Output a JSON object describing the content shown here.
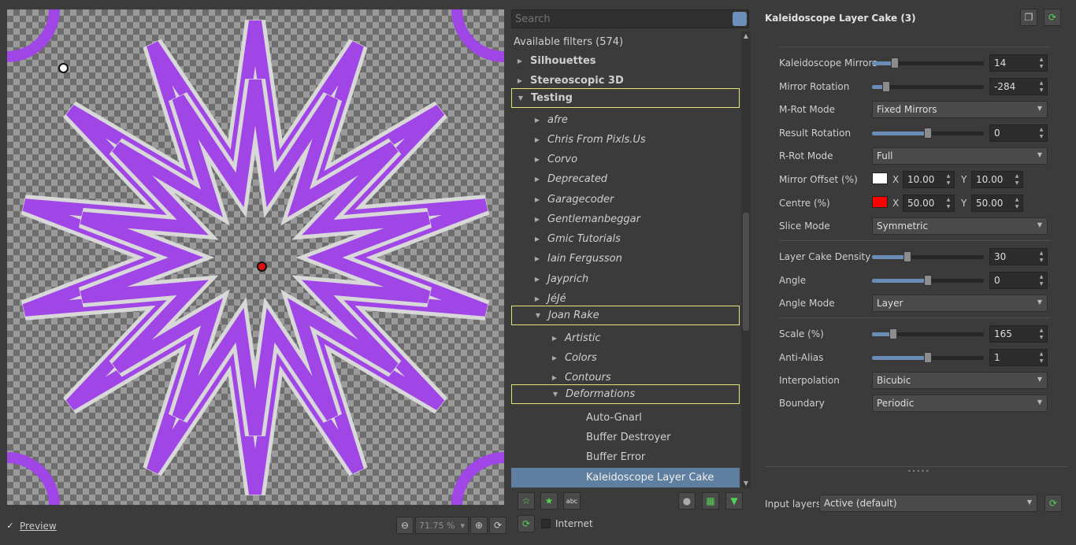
{
  "preview": {
    "checkbox_mark": "✓",
    "label": "Preview",
    "zoom": "71.75 %",
    "zoom_caret": "▾"
  },
  "search": {
    "placeholder": "Search"
  },
  "tree": {
    "header": "Available filters (574)",
    "rows": [
      {
        "label": "Silhouettes",
        "arrow": "▶"
      },
      {
        "label": "Stereoscopic 3D",
        "arrow": "▶"
      },
      {
        "label": "Testing",
        "arrow": "▼"
      },
      {
        "label": "afre",
        "arrow": "▶"
      },
      {
        "label": "Chris From Pixls.Us",
        "arrow": "▶"
      },
      {
        "label": "Corvo",
        "arrow": "▶"
      },
      {
        "label": "Deprecated",
        "arrow": "▶"
      },
      {
        "label": "Garagecoder",
        "arrow": "▶"
      },
      {
        "label": "Gentlemanbeggar",
        "arrow": "▶"
      },
      {
        "label": "Gmic Tutorials",
        "arrow": "▶"
      },
      {
        "label": "Iain Fergusson",
        "arrow": "▶"
      },
      {
        "label": "Jayprich",
        "arrow": "▶"
      },
      {
        "label": "JéJé",
        "arrow": "▶"
      },
      {
        "label": "Joan Rake",
        "arrow": "▼"
      },
      {
        "label": "Artistic",
        "arrow": "▶"
      },
      {
        "label": "Colors",
        "arrow": "▶"
      },
      {
        "label": "Contours",
        "arrow": "▶"
      },
      {
        "label": "Deformations",
        "arrow": "▼"
      },
      {
        "label": "Auto-Gnarl",
        "arrow": ""
      },
      {
        "label": "Buffer Destroyer",
        "arrow": ""
      },
      {
        "label": "Buffer Error",
        "arrow": ""
      },
      {
        "label": "Kaleidoscope Layer Cake",
        "arrow": ""
      }
    ]
  },
  "toolbar": {
    "internet_label": "Internet"
  },
  "filter": {
    "title": "Kaleidoscope Layer Cake (3)",
    "params": {
      "mirrors": {
        "label": "Kaleidoscope Mirrors",
        "value": "14",
        "level": 0.18
      },
      "mirror_rot": {
        "label": "Mirror Rotation",
        "value": "-284",
        "level": 0.1
      },
      "mrot_mode": {
        "label": "M-Rot Mode",
        "value": "Fixed Mirrors"
      },
      "result_rot": {
        "label": "Result Rotation",
        "value": "0",
        "level": 0.5
      },
      "rrot_mode": {
        "label": "R-Rot Mode",
        "value": "Full"
      },
      "mirror_offset": {
        "label": "Mirror Offset (%)",
        "color": "#ffffff",
        "x_label": "X",
        "x": "10.00",
        "y_label": "Y",
        "y": "10.00"
      },
      "centre": {
        "label": "Centre (%)",
        "color": "#ff0000",
        "x_label": "X",
        "x": "50.00",
        "y_label": "Y",
        "y": "50.00"
      },
      "slice_mode": {
        "label": "Slice Mode",
        "value": "Symmetric"
      },
      "density": {
        "label": "Layer Cake Density",
        "value": "30",
        "level": 0.3
      },
      "angle": {
        "label": "Angle",
        "value": "0",
        "level": 0.5
      },
      "angle_mode": {
        "label": "Angle Mode",
        "value": "Layer"
      },
      "scale": {
        "label": "Scale (%)",
        "value": "165",
        "level": 0.17
      },
      "anti_alias": {
        "label": "Anti-Alias",
        "value": "1",
        "level": 0.5
      },
      "interpolation": {
        "label": "Interpolation",
        "value": "Bicubic"
      },
      "boundary": {
        "label": "Boundary",
        "value": "Periodic"
      }
    }
  },
  "input_layers": {
    "label": "Input layers",
    "value": "Active (default)"
  },
  "colors": {
    "accent": "#6a8db5",
    "shape": "#a046e6",
    "selection": "#5e7fa0",
    "highlight_box": "#e4e47a"
  }
}
